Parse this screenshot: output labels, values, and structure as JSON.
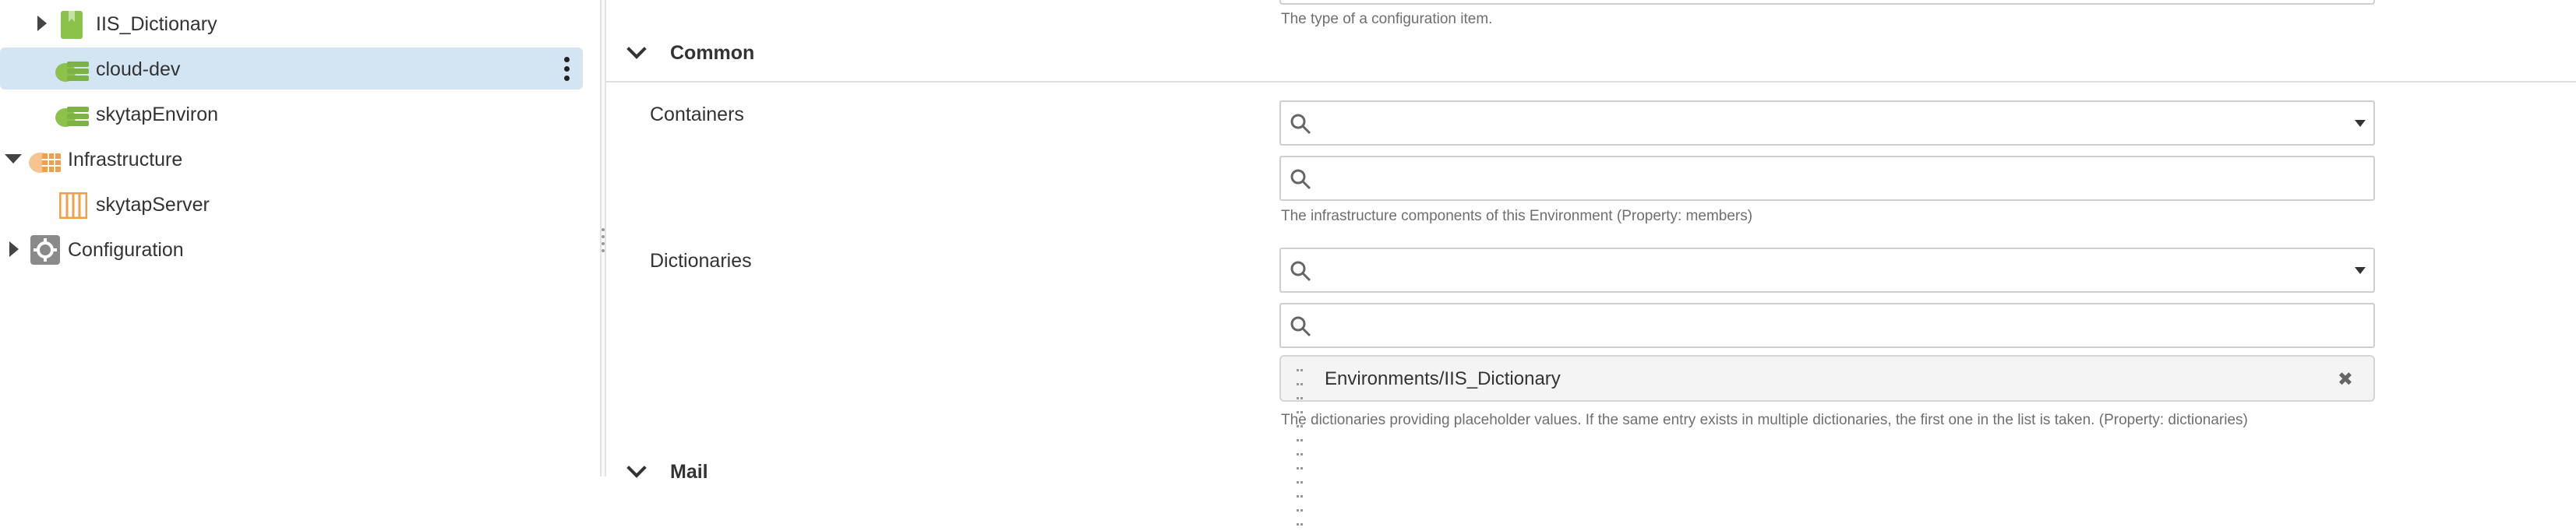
{
  "sidebar": {
    "items": [
      {
        "label": "IIS_Dictionary",
        "icon": "dictionary-icon",
        "expand": "collapsed"
      },
      {
        "label": "cloud-dev",
        "icon": "environment-icon",
        "selected": true
      },
      {
        "label": "skytapEnviron",
        "icon": "environment-icon"
      },
      {
        "label": "Infrastructure",
        "icon": "infrastructure-cloud-icon",
        "expand": "expanded"
      },
      {
        "label": "skytapServer",
        "icon": "server-icon"
      },
      {
        "label": "Configuration",
        "icon": "gear-icon",
        "expand": "collapsed"
      }
    ]
  },
  "form": {
    "type_help": "The type of a configuration item.",
    "section_common": "Common",
    "containers": {
      "label": "Containers",
      "help": "The infrastructure components of this Environment (Property: members)"
    },
    "dictionaries": {
      "label": "Dictionaries",
      "chip_label": "Environments/IIS_Dictionary",
      "help": "The dictionaries providing placeholder values. If the same entry exists in multiple dictionaries, the first one in the list is taken. (Property: dictionaries)"
    },
    "section_mail": "Mail"
  },
  "icons": {
    "remove": "✖"
  },
  "colors": {
    "selected_row": "#d3e5f2",
    "env_green": "#8bc34a",
    "infra_orange": "#f0a04b"
  }
}
